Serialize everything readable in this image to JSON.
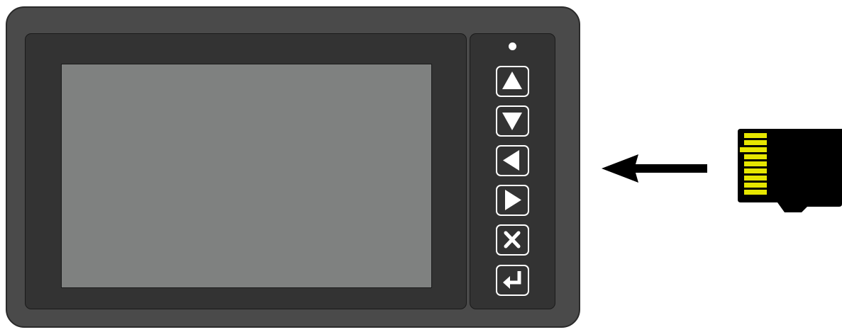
{
  "device": {
    "buttons": [
      {
        "name": "up-button",
        "icon": "triangle-up-icon"
      },
      {
        "name": "down-button",
        "icon": "triangle-down-icon"
      },
      {
        "name": "left-button",
        "icon": "triangle-left-icon"
      },
      {
        "name": "right-button",
        "icon": "triangle-right-icon"
      },
      {
        "name": "cancel-button",
        "icon": "x-icon"
      },
      {
        "name": "enter-button",
        "icon": "enter-return-icon"
      }
    ],
    "status_led": "white"
  },
  "insert_arrow": {
    "direction": "left"
  },
  "sd_card": {
    "type": "microSD",
    "contacts": 8
  },
  "colors": {
    "housing": "#4a4a4a",
    "bezel": "#333333",
    "screen": "#7f8180",
    "icon": "#ffffff",
    "card_body": "#000000",
    "card_contacts": "#e0e000"
  }
}
